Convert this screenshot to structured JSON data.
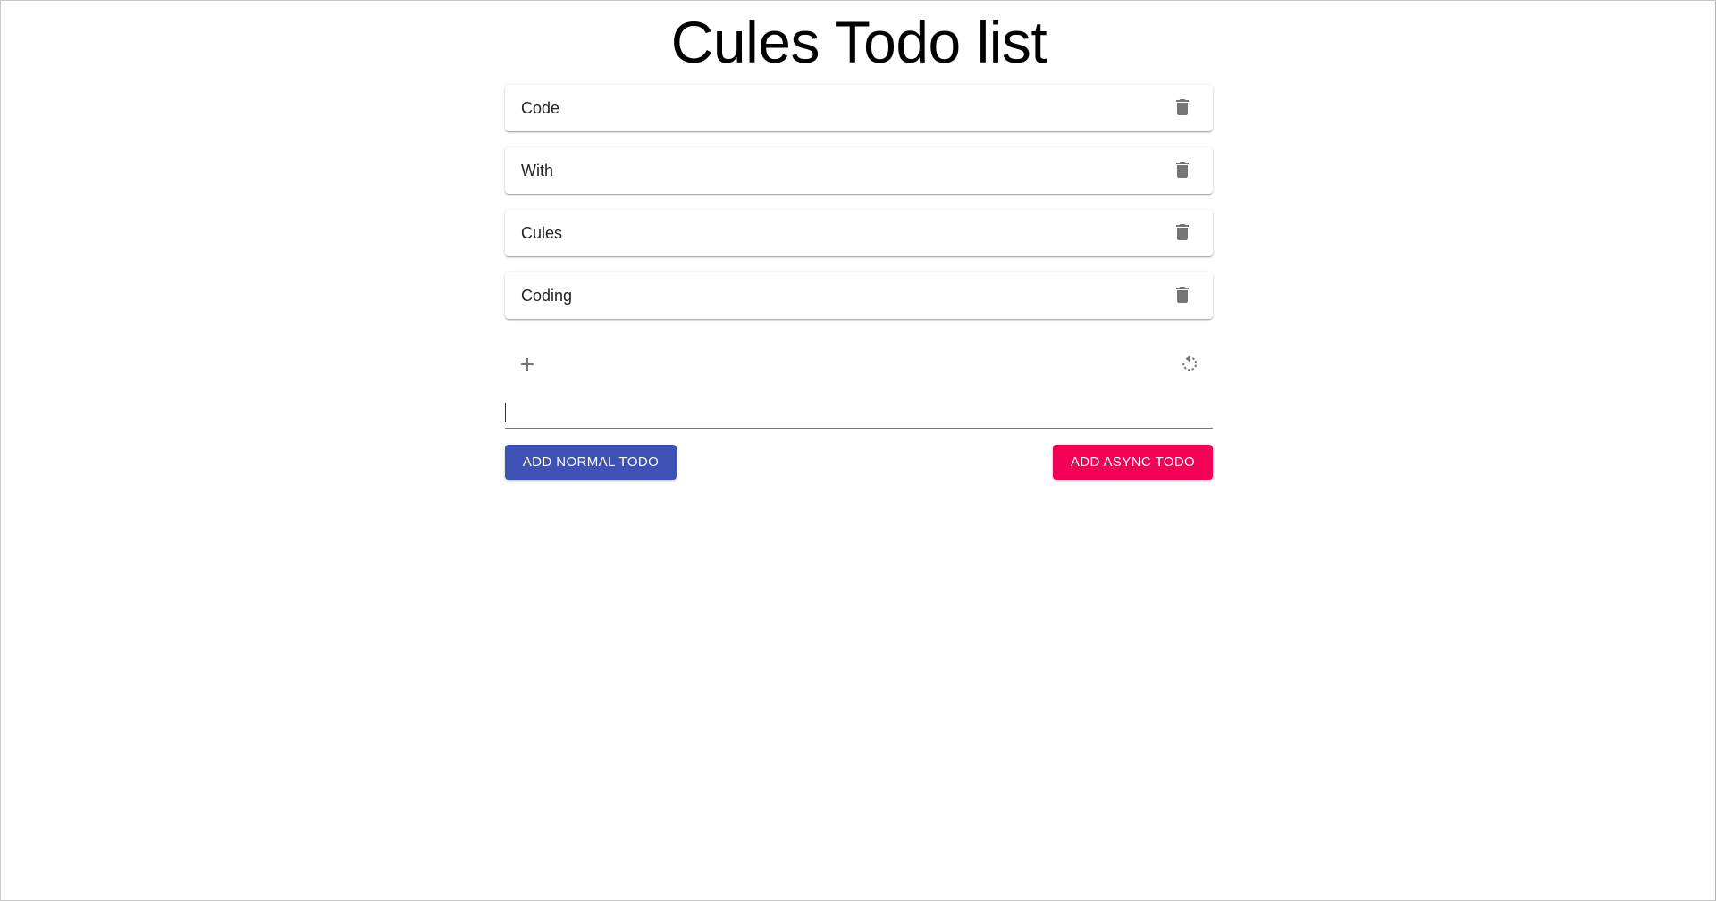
{
  "title": "Cules Todo list",
  "todos": [
    {
      "label": "Code",
      "delete_icon": "trash-icon"
    },
    {
      "label": "With",
      "delete_icon": "trash-icon"
    },
    {
      "label": "Cules",
      "delete_icon": "trash-icon"
    },
    {
      "label": "Coding",
      "delete_icon": "trash-icon"
    }
  ],
  "actions": {
    "add_icon": "plus-icon",
    "refresh_icon": "refresh-icon"
  },
  "input": {
    "value": "",
    "placeholder": ""
  },
  "buttons": {
    "normal_label": "Add Normal Todo",
    "async_label": "Add Async Todo"
  },
  "colors": {
    "primary": "#3f51b5",
    "secondary": "#f50057",
    "icon": "#757575"
  }
}
